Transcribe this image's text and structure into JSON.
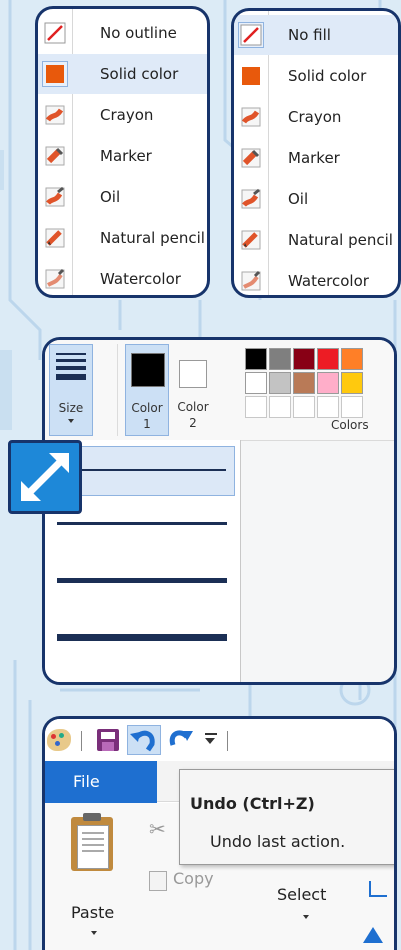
{
  "outline_menu": {
    "items": [
      {
        "label": "No outline",
        "icon": "no-outline-icon"
      },
      {
        "label": "Solid color",
        "icon": "solid-color-icon"
      },
      {
        "label": "Crayon",
        "icon": "crayon-icon"
      },
      {
        "label": "Marker",
        "icon": "marker-icon"
      },
      {
        "label": "Oil",
        "icon": "oil-icon"
      },
      {
        "label": "Natural pencil",
        "icon": "natural-pencil-icon"
      },
      {
        "label": "Watercolor",
        "icon": "watercolor-icon"
      }
    ],
    "selected_index": 1
  },
  "fill_menu": {
    "items": [
      {
        "label": "No fill",
        "icon": "no-fill-icon"
      },
      {
        "label": "Solid color",
        "icon": "solid-color-icon"
      },
      {
        "label": "Crayon",
        "icon": "crayon-icon"
      },
      {
        "label": "Marker",
        "icon": "marker-icon"
      },
      {
        "label": "Oil",
        "icon": "oil-icon"
      },
      {
        "label": "Natural pencil",
        "icon": "natural-pencil-icon"
      },
      {
        "label": "Watercolor",
        "icon": "watercolor-icon"
      }
    ],
    "selected_index": 0
  },
  "ribbon": {
    "size_label": "Size",
    "color1_label": "Color",
    "color1_num": "1",
    "color2_label": "Color",
    "color2_num": "2",
    "colors_group_label": "Colors",
    "color1_value": "#000000",
    "color2_value": "#ffffff",
    "palette_row1": [
      "#000000",
      "#7f7f7f",
      "#880015",
      "#ed1c24",
      "#ff7f27"
    ],
    "palette_row2": [
      "#ffffff",
      "#c3c3c3",
      "#b97a57",
      "#ffaec9",
      "#ffc90e"
    ],
    "palette_row3": [
      "#ffffff",
      "#ffffff",
      "#ffffff",
      "#ffffff",
      "#ffffff"
    ],
    "size_options": 4,
    "selected_size": 1
  },
  "toolbar": {
    "file_tab": "File",
    "undo_tooltip_title": "Undo (Ctrl+Z)",
    "undo_tooltip_desc": "Undo last action.",
    "paste_label": "Paste",
    "copy_label": "Copy",
    "select_label": "Select"
  },
  "colors": {
    "frame": "#17346b",
    "accent_orange": "#e8590c",
    "file_tab": "#1e6fd0",
    "expand_badge": "#1e88d8"
  }
}
